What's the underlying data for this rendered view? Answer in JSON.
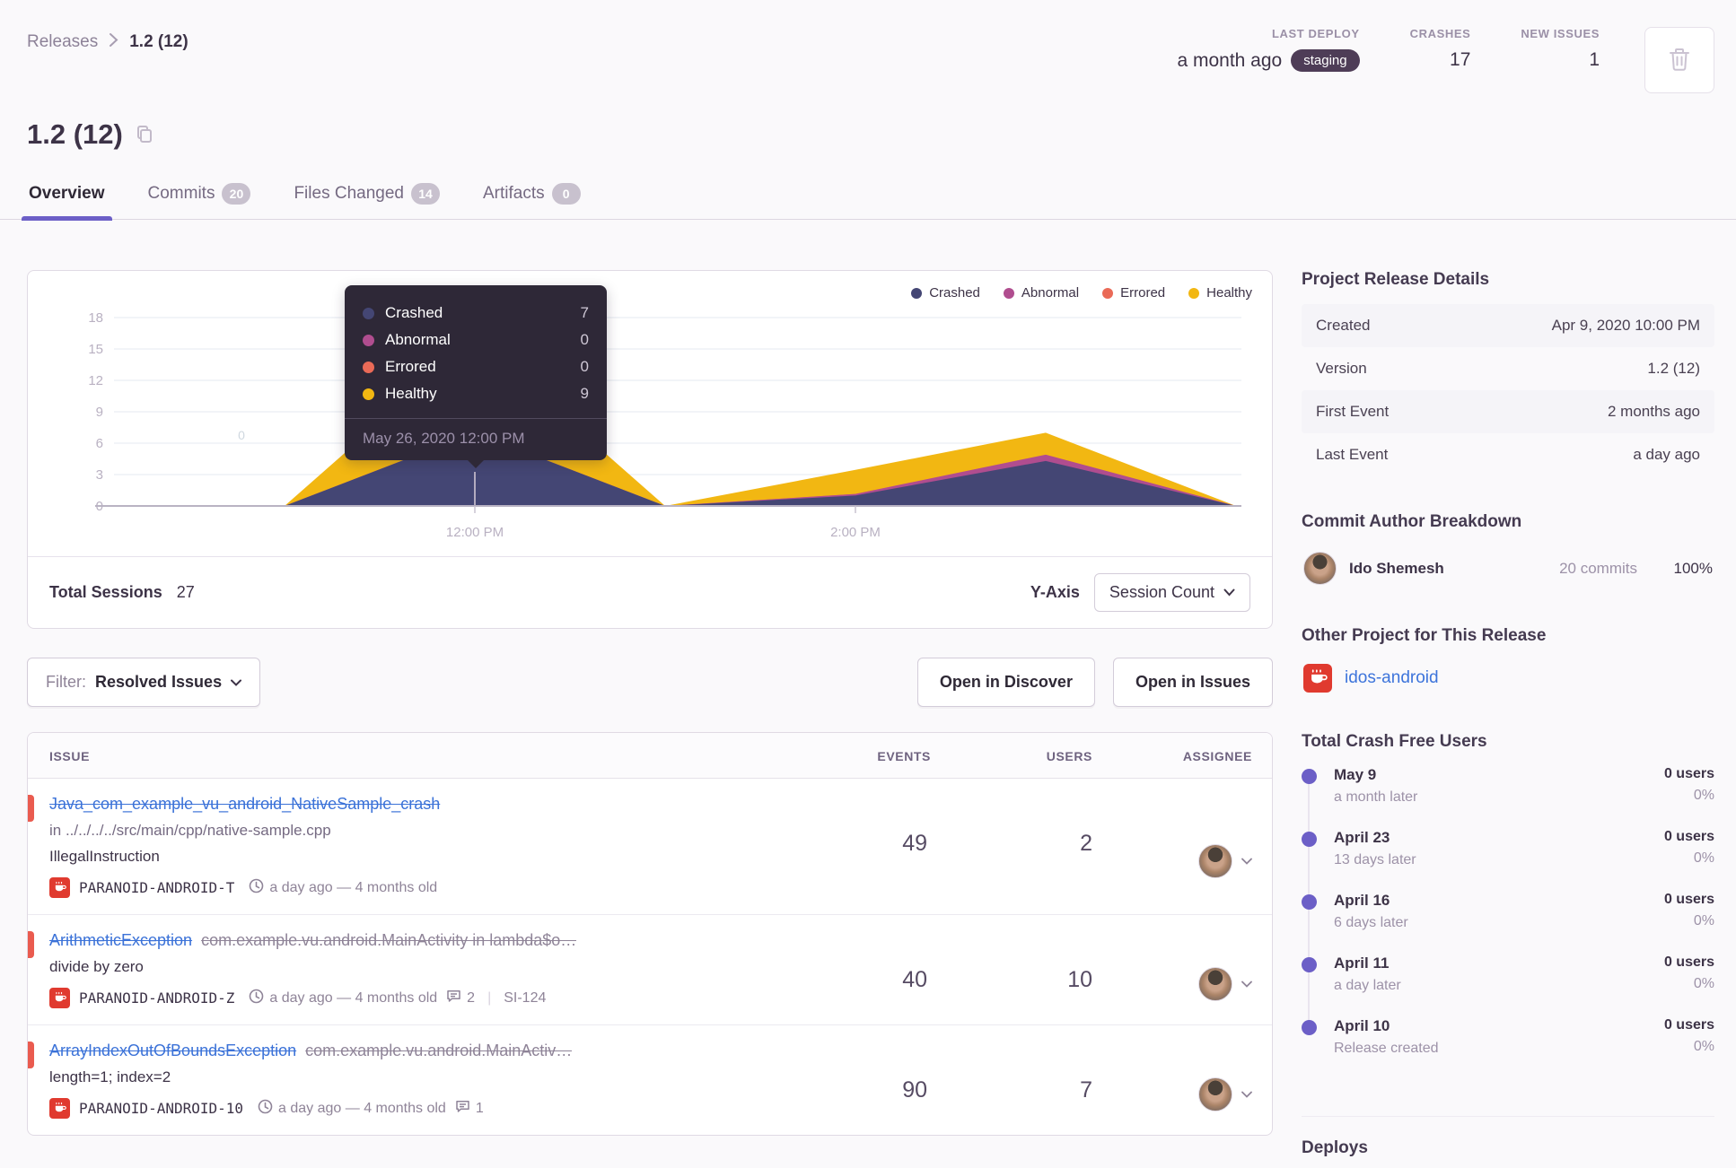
{
  "breadcrumb": {
    "parent": "Releases",
    "separator": "›",
    "current": "1.2 (12)"
  },
  "header_stats": {
    "last_deploy": {
      "label": "LAST DEPLOY",
      "value": "a month ago",
      "env": "staging"
    },
    "crashes": {
      "label": "CRASHES",
      "value": "17"
    },
    "new_issues": {
      "label": "NEW ISSUES",
      "value": "1"
    }
  },
  "page": {
    "title": "1.2 (12)"
  },
  "tabs": [
    {
      "label": "Overview",
      "badge": null
    },
    {
      "label": "Commits",
      "badge": "20"
    },
    {
      "label": "Files Changed",
      "badge": "14"
    },
    {
      "label": "Artifacts",
      "badge": "0"
    }
  ],
  "chart_data": {
    "type": "area",
    "stacked": true,
    "x": [
      "10:00 AM",
      "11:00 AM",
      "12:00 PM",
      "1:00 PM",
      "2:00 PM",
      "3:00 PM",
      "4:00 PM"
    ],
    "series": [
      {
        "name": "Crashed",
        "color": "#444674",
        "values": [
          0,
          0,
          7,
          0,
          1,
          4.3,
          0
        ]
      },
      {
        "name": "Abnormal",
        "color": "#b04d8f",
        "values": [
          0,
          0,
          0,
          0,
          0.15,
          0.6,
          0
        ]
      },
      {
        "name": "Errored",
        "color": "#ea6a57",
        "values": [
          0,
          0,
          0,
          0,
          0,
          0,
          0
        ]
      },
      {
        "name": "Healthy",
        "color": "#f2b712",
        "values": [
          0,
          0,
          9,
          0,
          2.3,
          2.1,
          0
        ]
      }
    ],
    "ylim": [
      0,
      18
    ],
    "yticks": [
      0,
      3,
      6,
      9,
      12,
      15,
      18
    ],
    "x_axis_labels": [
      {
        "label": "12:00 PM",
        "index": 2
      },
      {
        "label": "2:00 PM",
        "index": 4
      }
    ],
    "grid": true,
    "legend_position": "top-right",
    "ylabel": "Session Count"
  },
  "chart": {
    "ghost_label": "0",
    "tooltip": {
      "date": "May 26, 2020 12:00 PM",
      "rows": [
        {
          "name": "Crashed",
          "value": "7"
        },
        {
          "name": "Abnormal",
          "value": "0"
        },
        {
          "name": "Errored",
          "value": "0"
        },
        {
          "name": "Healthy",
          "value": "9"
        }
      ]
    },
    "footer": {
      "sessions_label": "Total Sessions",
      "sessions_value": "27",
      "yaxis_label": "Y-Axis",
      "yaxis_value": "Session Count"
    }
  },
  "filter": {
    "label": "Filter:",
    "value": "Resolved Issues"
  },
  "actions": {
    "discover": "Open in Discover",
    "issues": "Open in Issues"
  },
  "issues": {
    "columns": {
      "issue": "ISSUE",
      "events": "EVENTS",
      "users": "USERS",
      "assignee": "ASSIGNEE"
    },
    "rows": [
      {
        "title": "Java_com_example_vu_android_NativeSample_crash",
        "subtitle": null,
        "culprit": "in ../../../../src/main/cpp/native-sample.cpp",
        "message": "IllegalInstruction",
        "project_tag": "PARANOID-ANDROID-T",
        "age": "a day ago — 4 months old",
        "comments": null,
        "short_id": null,
        "events": "49",
        "users": "2"
      },
      {
        "title": "ArithmeticException",
        "subtitle": "com.example.vu.android.MainActivity in lambda$o…",
        "culprit": null,
        "message": "divide by zero",
        "project_tag": "PARANOID-ANDROID-Z",
        "age": "a day ago — 4 months old",
        "comments": "2",
        "short_id": "SI-124",
        "events": "40",
        "users": "10"
      },
      {
        "title": "ArrayIndexOutOfBoundsException",
        "subtitle": "com.example.vu.android.MainActiv…",
        "culprit": null,
        "message": "length=1; index=2",
        "project_tag": "PARANOID-ANDROID-10",
        "age": "a day ago — 4 months old",
        "comments": "1",
        "short_id": null,
        "events": "90",
        "users": "7"
      }
    ]
  },
  "sidebar": {
    "release_details": {
      "heading": "Project Release Details",
      "rows": [
        {
          "label": "Created",
          "value": "Apr 9, 2020 10:00 PM"
        },
        {
          "label": "Version",
          "value": "1.2 (12)"
        },
        {
          "label": "First Event",
          "value": "2 months ago"
        },
        {
          "label": "Last Event",
          "value": "a day ago"
        }
      ]
    },
    "commit_authors": {
      "heading": "Commit Author Breakdown",
      "author": {
        "name": "Ido Shemesh",
        "commits": "20 commits",
        "percent": "100%"
      }
    },
    "other_project": {
      "heading": "Other Project for This Release",
      "name": "idos-android"
    },
    "crash_free": {
      "heading": "Total Crash Free Users",
      "items": [
        {
          "date": "May 9",
          "note": "a month later",
          "users": "0 users",
          "percent": "0%"
        },
        {
          "date": "April 23",
          "note": "13 days later",
          "users": "0 users",
          "percent": "0%"
        },
        {
          "date": "April 16",
          "note": "6 days later",
          "users": "0 users",
          "percent": "0%"
        },
        {
          "date": "April 11",
          "note": "a day later",
          "users": "0 users",
          "percent": "0%"
        },
        {
          "date": "April 10",
          "note": "Release created",
          "users": "0 users",
          "percent": "0%"
        }
      ]
    },
    "deploys": {
      "heading": "Deploys"
    }
  },
  "colors": {
    "accent": "#6c5fc7",
    "link": "#3d74db",
    "error": "#ea5b4f",
    "env_pill": "#4e3d57"
  }
}
